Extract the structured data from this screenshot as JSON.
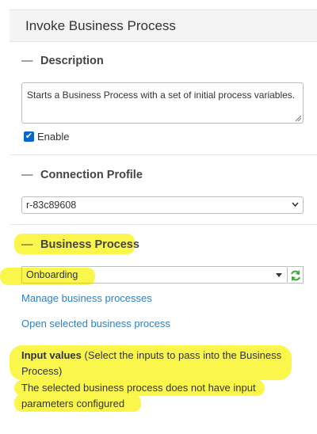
{
  "panel": {
    "title": "Invoke Business Process"
  },
  "description": {
    "heading": "Description",
    "text": "Starts a Business Process with a set of initial process variables.",
    "enable_label": "Enable",
    "enabled": true
  },
  "connection": {
    "heading": "Connection Profile",
    "selected": "r-83c89608"
  },
  "business_process": {
    "heading": "Business Process",
    "selected": "Onboarding",
    "manage_link": "Manage business processes",
    "open_link": "Open selected business process",
    "input_label": "Input values",
    "input_hint": "(Select the inputs to pass into the Business Process)",
    "no_params": "The selected business process does not have input parameters configured"
  },
  "colors": {
    "highlight": "#fbf64c",
    "link": "#2f7fbf",
    "checkbox": "#0a66c8",
    "refresh": "#3aa83a"
  },
  "icons": [
    "collapse-dash-icon",
    "chevron-down-icon",
    "caret-down-icon",
    "refresh-icon",
    "resize-grip-icon",
    "checkmark-icon"
  ]
}
